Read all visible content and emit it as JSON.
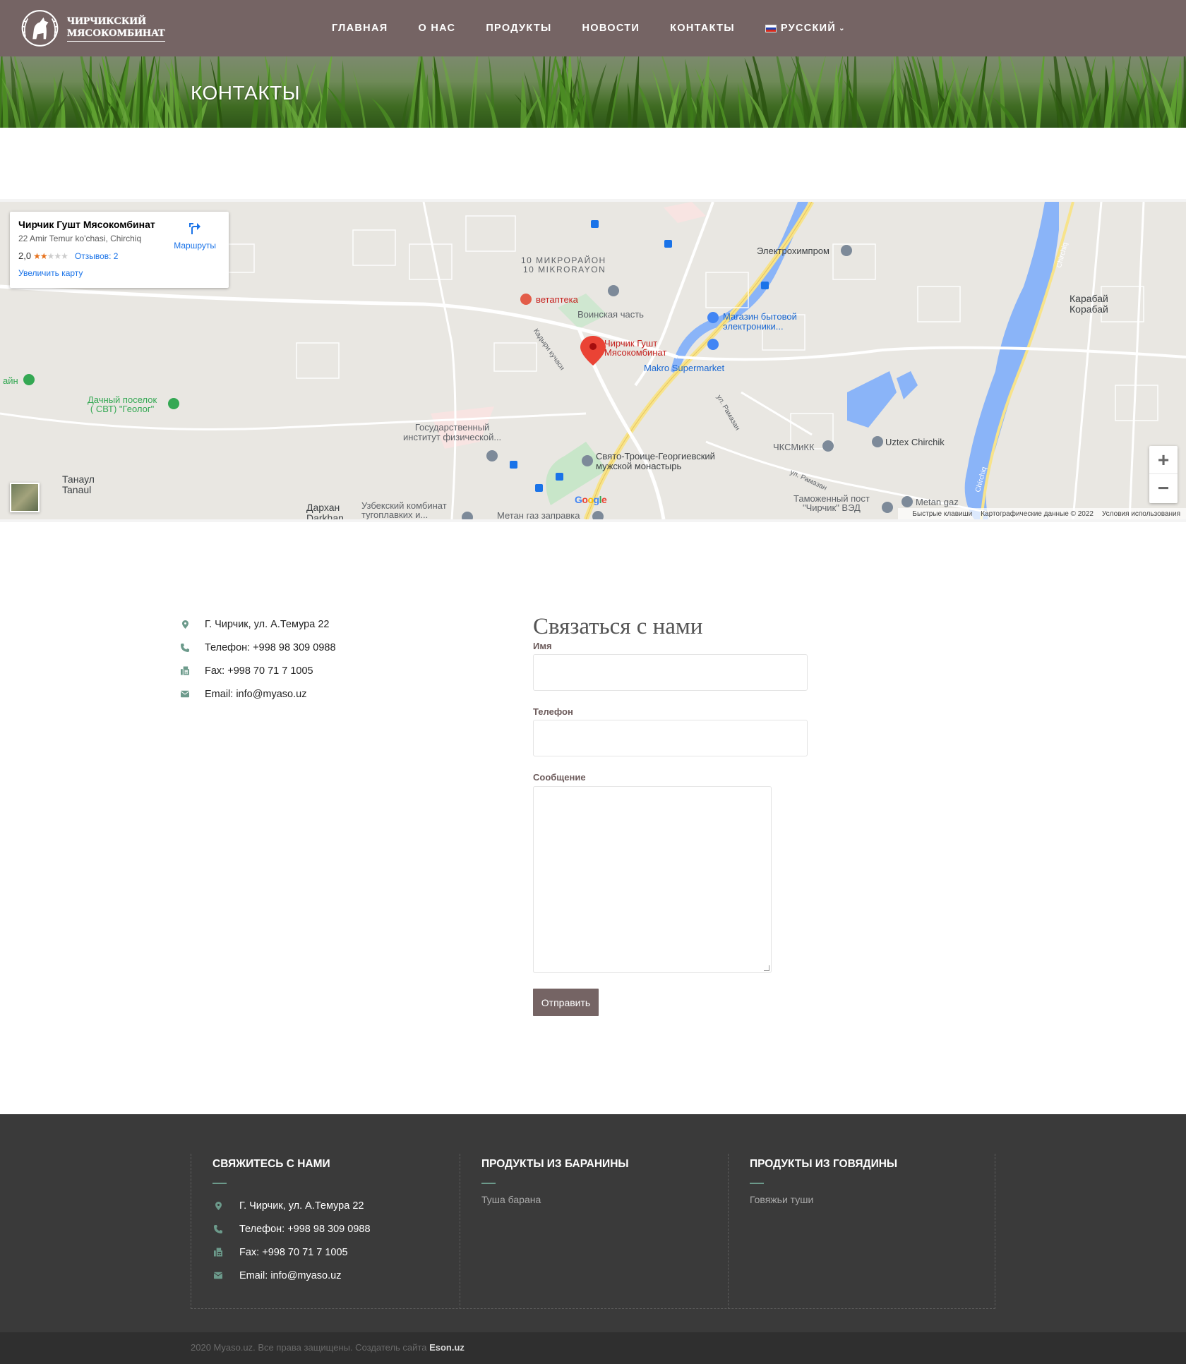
{
  "header": {
    "logo_line1": "Чирчикский",
    "logo_line2": "Мясокомбинат",
    "nav": [
      "ГЛАВНАЯ",
      "О НАС",
      "ПРОДУКТЫ",
      "НОВОСТИ",
      "КОНТАКТЫ"
    ],
    "language": "РУССКИЙ"
  },
  "banner": {
    "title": "КОНТАКТЫ"
  },
  "map": {
    "card": {
      "title": "Чирчик Гушт Мясокомбинат",
      "address": "22 Amir Temur ko'chasi, Chirchiq",
      "rating": "2,0",
      "stars_filled": 2,
      "reviews": "Отзывов: 2",
      "enlarge": "Увеличить карту",
      "routes": "Маршруты"
    },
    "labels": {
      "district1": "10 МИКРОРАЙОН",
      "district2": "10 MIKRORAYON",
      "vet": "ветаптека",
      "military": "Воинская часть",
      "street1": "Кадыри кучаси",
      "marker1": "Чирчик Гушт",
      "marker2": "Мясокомбинат",
      "electro": "Электрохимпром",
      "store1": "Магазин бытовой",
      "store2": "электроники...",
      "makro": "Makro Supermarket",
      "karabay1": "Карабай",
      "karabay2": "Корабай",
      "dacha1": "Дачный поселок",
      "dacha2": "( СВТ) \"Геолог\"",
      "aym": "айн",
      "inst1": "Государственный",
      "inst2": "институт физической...",
      "monastery1": "Свято-Троице-Георгиевский",
      "monastery2": "мужской монастырь",
      "chsmikk": "ЧКСМиКК",
      "uztex": "Uztex Chirchik",
      "ramazan1": "ул. Рамазан",
      "ramazan2": "ул. Рамазан",
      "tanaul1": "Танаул",
      "tanaul2": "Tanaul",
      "darhan1": "Дархан",
      "darhan2": "Darkhan",
      "kombinat1": "Узбекский комбинат",
      "kombinat2": "тугоплавких и...",
      "metan1": "Метан газ заправка",
      "customs1": "Таможенный пост",
      "customs2": "\"Чирчик\" ВЭД",
      "metan2": "Metan gaz",
      "river": "Chirchiq",
      "river2": "Chirchiq",
      "google": "Google"
    },
    "footer": [
      "Быстрые клавиши",
      "Картографические данные © 2022",
      "Условия использования"
    ]
  },
  "contacts": {
    "address": "Г. Чирчик, ул. А.Темура 22",
    "phone": "Телефон: +998 98 309 0988",
    "fax": "Fax: +998 70 71 7 1005",
    "email": "Email: info@myaso.uz"
  },
  "form": {
    "title": "Связаться с нами",
    "name_label": "Имя",
    "phone_label": "Телефон",
    "message_label": "Сообщение",
    "submit": "Отправить"
  },
  "footer": {
    "col1_title": "СВЯЖИТЕСЬ С НАМИ",
    "col2_title": "ПРОДУКТЫ ИЗ БАРАНИНЫ",
    "col2_link": "Туша барана",
    "col3_title": "ПРОДУКТЫ ИЗ ГОВЯДИНЫ",
    "col3_link": "Говяжьи туши",
    "copyright": "2020 Myaso.uz. Все права защищены. Создатель сайта ",
    "creator": "Eson.uz"
  },
  "colors": {
    "header": "#756464",
    "footer": "#3a3a3a",
    "accent": "#6c9a8b",
    "button": "#756464"
  }
}
